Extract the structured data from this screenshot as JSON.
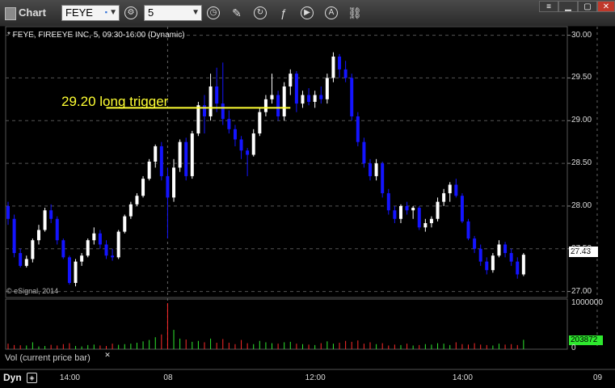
{
  "app": {
    "title": "Chart"
  },
  "toolbar": {
    "symbol": "FEYE",
    "interval": "5"
  },
  "chart_data": {
    "type": "candlestick",
    "title": "* FEYE, FIREEYE INC, 5, 09:30-16:00 (Dynamic)",
    "y_ticks": [
      "30.00",
      "29.50",
      "29.00",
      "28.50",
      "28.00",
      "27.50",
      "27.00"
    ],
    "ylim": [
      26.93,
      30.1
    ],
    "x_ticks": [
      {
        "label": "14:00",
        "i": 10
      },
      {
        "label": "08",
        "i": 26
      },
      {
        "label": "12:00",
        "i": 50
      },
      {
        "label": "14:00",
        "i": 74
      },
      {
        "label": "09",
        "i": 96
      }
    ],
    "session_breaks": [
      26,
      96
    ],
    "last_price": "27.43",
    "annotation": {
      "text": "29.20 long trigger",
      "price": 29.15,
      "from": 16,
      "to": 46
    },
    "ohlc": [
      [
        28.0,
        28.05,
        27.78,
        27.85
      ],
      [
        27.85,
        27.9,
        27.4,
        27.45
      ],
      [
        27.45,
        27.5,
        27.28,
        27.3
      ],
      [
        27.3,
        27.42,
        27.28,
        27.38
      ],
      [
        27.38,
        27.62,
        27.34,
        27.6
      ],
      [
        27.6,
        27.78,
        27.55,
        27.72
      ],
      [
        27.72,
        27.98,
        27.7,
        27.95
      ],
      [
        27.95,
        28.02,
        27.8,
        27.85
      ],
      [
        27.85,
        27.88,
        27.55,
        27.6
      ],
      [
        27.6,
        27.62,
        27.38,
        27.4
      ],
      [
        27.4,
        27.42,
        27.08,
        27.1
      ],
      [
        27.1,
        27.38,
        27.06,
        27.35
      ],
      [
        27.35,
        27.45,
        27.3,
        27.42
      ],
      [
        27.42,
        27.62,
        27.4,
        27.6
      ],
      [
        27.6,
        27.75,
        27.55,
        27.68
      ],
      [
        27.68,
        27.72,
        27.5,
        27.55
      ],
      [
        27.55,
        27.6,
        27.38,
        27.42
      ],
      [
        27.42,
        27.5,
        27.36,
        27.4
      ],
      [
        27.4,
        27.72,
        27.38,
        27.7
      ],
      [
        27.7,
        27.9,
        27.68,
        27.88
      ],
      [
        27.88,
        28.05,
        27.85,
        28.02
      ],
      [
        28.02,
        28.15,
        28.0,
        28.12
      ],
      [
        28.12,
        28.35,
        28.1,
        28.32
      ],
      [
        28.32,
        28.55,
        28.3,
        28.52
      ],
      [
        28.52,
        28.72,
        28.45,
        28.7
      ],
      [
        28.7,
        28.75,
        28.3,
        28.35
      ],
      [
        28.35,
        28.45,
        27.62,
        28.1
      ],
      [
        28.1,
        28.55,
        28.05,
        28.45
      ],
      [
        28.45,
        28.78,
        28.4,
        28.75
      ],
      [
        28.75,
        28.8,
        28.3,
        28.35
      ],
      [
        28.35,
        28.88,
        28.32,
        28.85
      ],
      [
        28.85,
        29.22,
        28.82,
        29.18
      ],
      [
        29.18,
        29.3,
        28.85,
        29.05
      ],
      [
        29.05,
        29.55,
        29.0,
        29.4
      ],
      [
        29.4,
        29.62,
        29.1,
        29.2
      ],
      [
        29.2,
        29.68,
        28.95,
        29.02
      ],
      [
        29.02,
        29.12,
        28.85,
        28.9
      ],
      [
        28.9,
        28.95,
        28.7,
        28.78
      ],
      [
        28.78,
        28.82,
        28.55,
        28.65
      ],
      [
        28.65,
        28.68,
        28.35,
        28.6
      ],
      [
        28.6,
        28.9,
        28.58,
        28.85
      ],
      [
        28.85,
        29.15,
        28.82,
        29.1
      ],
      [
        29.1,
        29.3,
        29.05,
        29.25
      ],
      [
        29.25,
        29.55,
        29.2,
        29.3
      ],
      [
        29.3,
        29.35,
        29.0,
        29.05
      ],
      [
        29.05,
        29.45,
        29.0,
        29.4
      ],
      [
        29.4,
        29.6,
        29.3,
        29.55
      ],
      [
        29.55,
        29.58,
        29.1,
        29.2
      ],
      [
        29.2,
        29.35,
        29.15,
        29.3
      ],
      [
        29.3,
        29.38,
        29.18,
        29.22
      ],
      [
        29.22,
        29.35,
        29.15,
        29.3
      ],
      [
        29.3,
        29.4,
        29.2,
        29.25
      ],
      [
        29.25,
        29.55,
        29.2,
        29.5
      ],
      [
        29.5,
        29.8,
        29.45,
        29.75
      ],
      [
        29.75,
        29.78,
        29.5,
        29.6
      ],
      [
        29.6,
        29.7,
        29.45,
        29.5
      ],
      [
        29.5,
        29.55,
        29.0,
        29.05
      ],
      [
        29.05,
        29.1,
        28.7,
        28.75
      ],
      [
        28.75,
        28.8,
        28.45,
        28.5
      ],
      [
        28.5,
        28.55,
        28.3,
        28.35
      ],
      [
        28.35,
        28.55,
        28.3,
        28.5
      ],
      [
        28.5,
        28.52,
        28.1,
        28.15
      ],
      [
        28.15,
        28.2,
        27.9,
        27.95
      ],
      [
        27.95,
        28.0,
        27.8,
        27.85
      ],
      [
        27.85,
        28.02,
        27.8,
        28.0
      ],
      [
        28.0,
        28.05,
        27.9,
        27.95
      ],
      [
        27.95,
        28.0,
        27.85,
        27.98
      ],
      [
        27.98,
        28.0,
        27.72,
        27.75
      ],
      [
        27.75,
        27.85,
        27.7,
        27.8
      ],
      [
        27.8,
        27.88,
        27.75,
        27.85
      ],
      [
        27.85,
        28.1,
        27.82,
        28.05
      ],
      [
        28.05,
        28.2,
        28.0,
        28.15
      ],
      [
        28.15,
        28.28,
        28.05,
        28.25
      ],
      [
        28.25,
        28.32,
        28.1,
        28.12
      ],
      [
        28.12,
        28.15,
        27.8,
        27.82
      ],
      [
        27.82,
        27.85,
        27.6,
        27.62
      ],
      [
        27.62,
        27.65,
        27.45,
        27.5
      ],
      [
        27.5,
        27.55,
        27.3,
        27.35
      ],
      [
        27.35,
        27.4,
        27.2,
        27.25
      ],
      [
        27.25,
        27.45,
        27.22,
        27.42
      ],
      [
        27.42,
        27.6,
        27.4,
        27.55
      ],
      [
        27.55,
        27.58,
        27.4,
        27.45
      ],
      [
        27.45,
        27.5,
        27.3,
        27.35
      ],
      [
        27.35,
        27.4,
        27.15,
        27.2
      ],
      [
        27.2,
        27.45,
        27.18,
        27.43
      ]
    ],
    "volume_ylim": [
      0,
      1000000
    ],
    "volume_ticks": [
      "1000000",
      "0"
    ],
    "volume_last": "203872",
    "volume": [
      120000,
      90000,
      85000,
      80000,
      150000,
      60000,
      70000,
      95000,
      80000,
      110000,
      130000,
      70000,
      60000,
      90000,
      100000,
      80000,
      70000,
      120000,
      95000,
      110000,
      120000,
      140000,
      170000,
      200000,
      260000,
      320000,
      1000000,
      420000,
      230000,
      210000,
      160000,
      180000,
      150000,
      230000,
      140000,
      220000,
      140000,
      110000,
      200000,
      130000,
      110000,
      180000,
      150000,
      130000,
      120000,
      150000,
      160000,
      120000,
      110000,
      100000,
      90000,
      130000,
      170000,
      120000,
      140000,
      180000,
      160000,
      190000,
      120000,
      150000,
      110000,
      130000,
      80000,
      100000,
      90000,
      120000,
      80000,
      90000,
      110000,
      100000,
      130000,
      120000,
      90000,
      150000,
      110000,
      100000,
      130000,
      100000,
      90000,
      80000,
      120000,
      100000,
      110000,
      90000,
      203872
    ]
  },
  "volume_panel": {
    "title": "Vol (current price bar)"
  },
  "footer": {
    "dyn": "Dyn",
    "copyright": "© eSignal, 2014"
  },
  "colors": {
    "up": "#ffffff",
    "down": "#1414ff",
    "trigger": "#ffff33",
    "vol_up": "#2ee82e",
    "vol_down": "#ff2a2a"
  }
}
